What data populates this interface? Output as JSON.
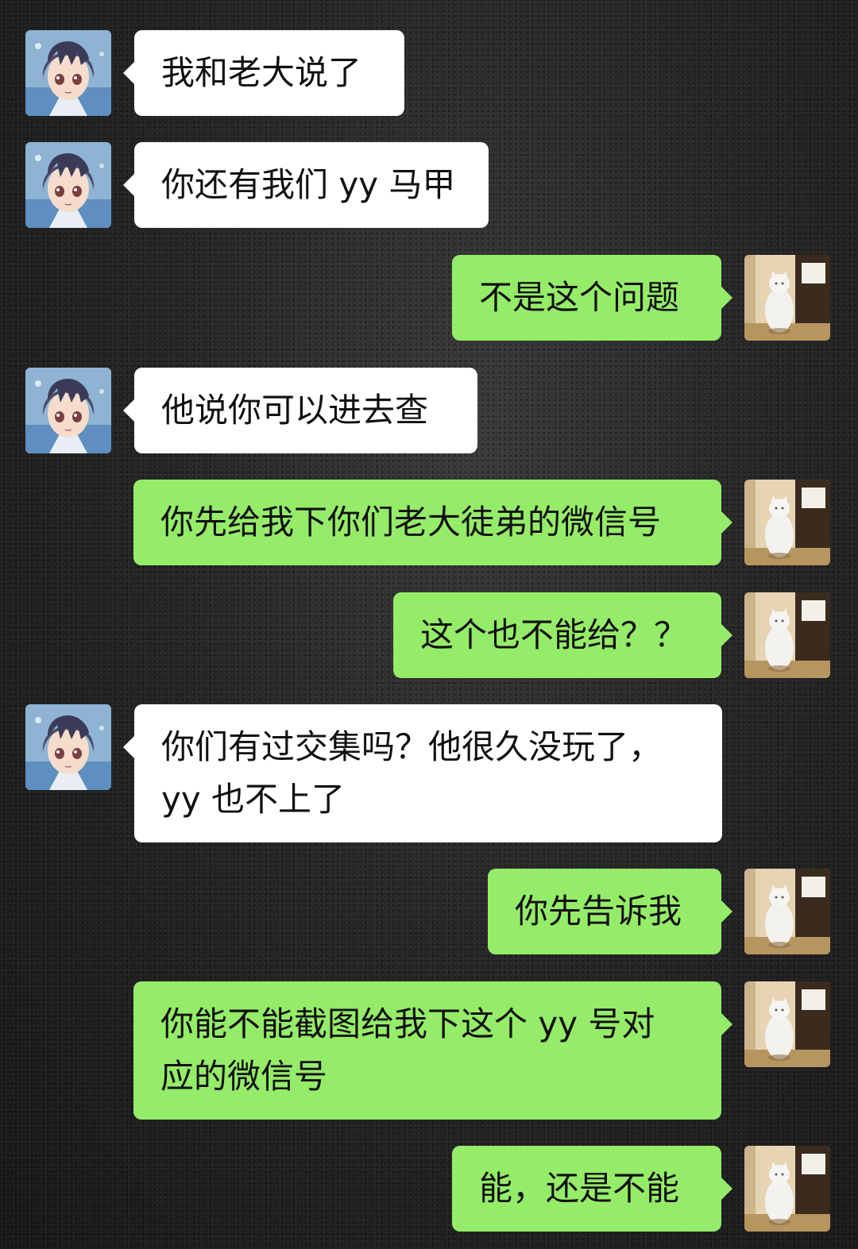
{
  "colors": {
    "incoming_bubble": "#ffffff",
    "outgoing_bubble": "#95ec69",
    "background": "#262626"
  },
  "avatars": {
    "contact": "anime-girl-avatar",
    "self": "white-cat-avatar"
  },
  "messages": [
    {
      "sender": "contact",
      "text": "我和老大说了"
    },
    {
      "sender": "contact",
      "text": "你还有我们 yy 马甲"
    },
    {
      "sender": "self",
      "text": "不是这个问题"
    },
    {
      "sender": "contact",
      "text": "他说你可以进去查"
    },
    {
      "sender": "self",
      "text": "你先给我下你们老大徒弟的微信号"
    },
    {
      "sender": "self",
      "text": "这个也不能给？？"
    },
    {
      "sender": "contact",
      "text": "你们有过交集吗？他很久没玩了，\nyy 也不上了"
    },
    {
      "sender": "self",
      "text": "你先告诉我"
    },
    {
      "sender": "self",
      "text": "你能不能截图给我下这个 yy 号对\n应的微信号"
    },
    {
      "sender": "self",
      "text": "能，还是不能"
    }
  ]
}
